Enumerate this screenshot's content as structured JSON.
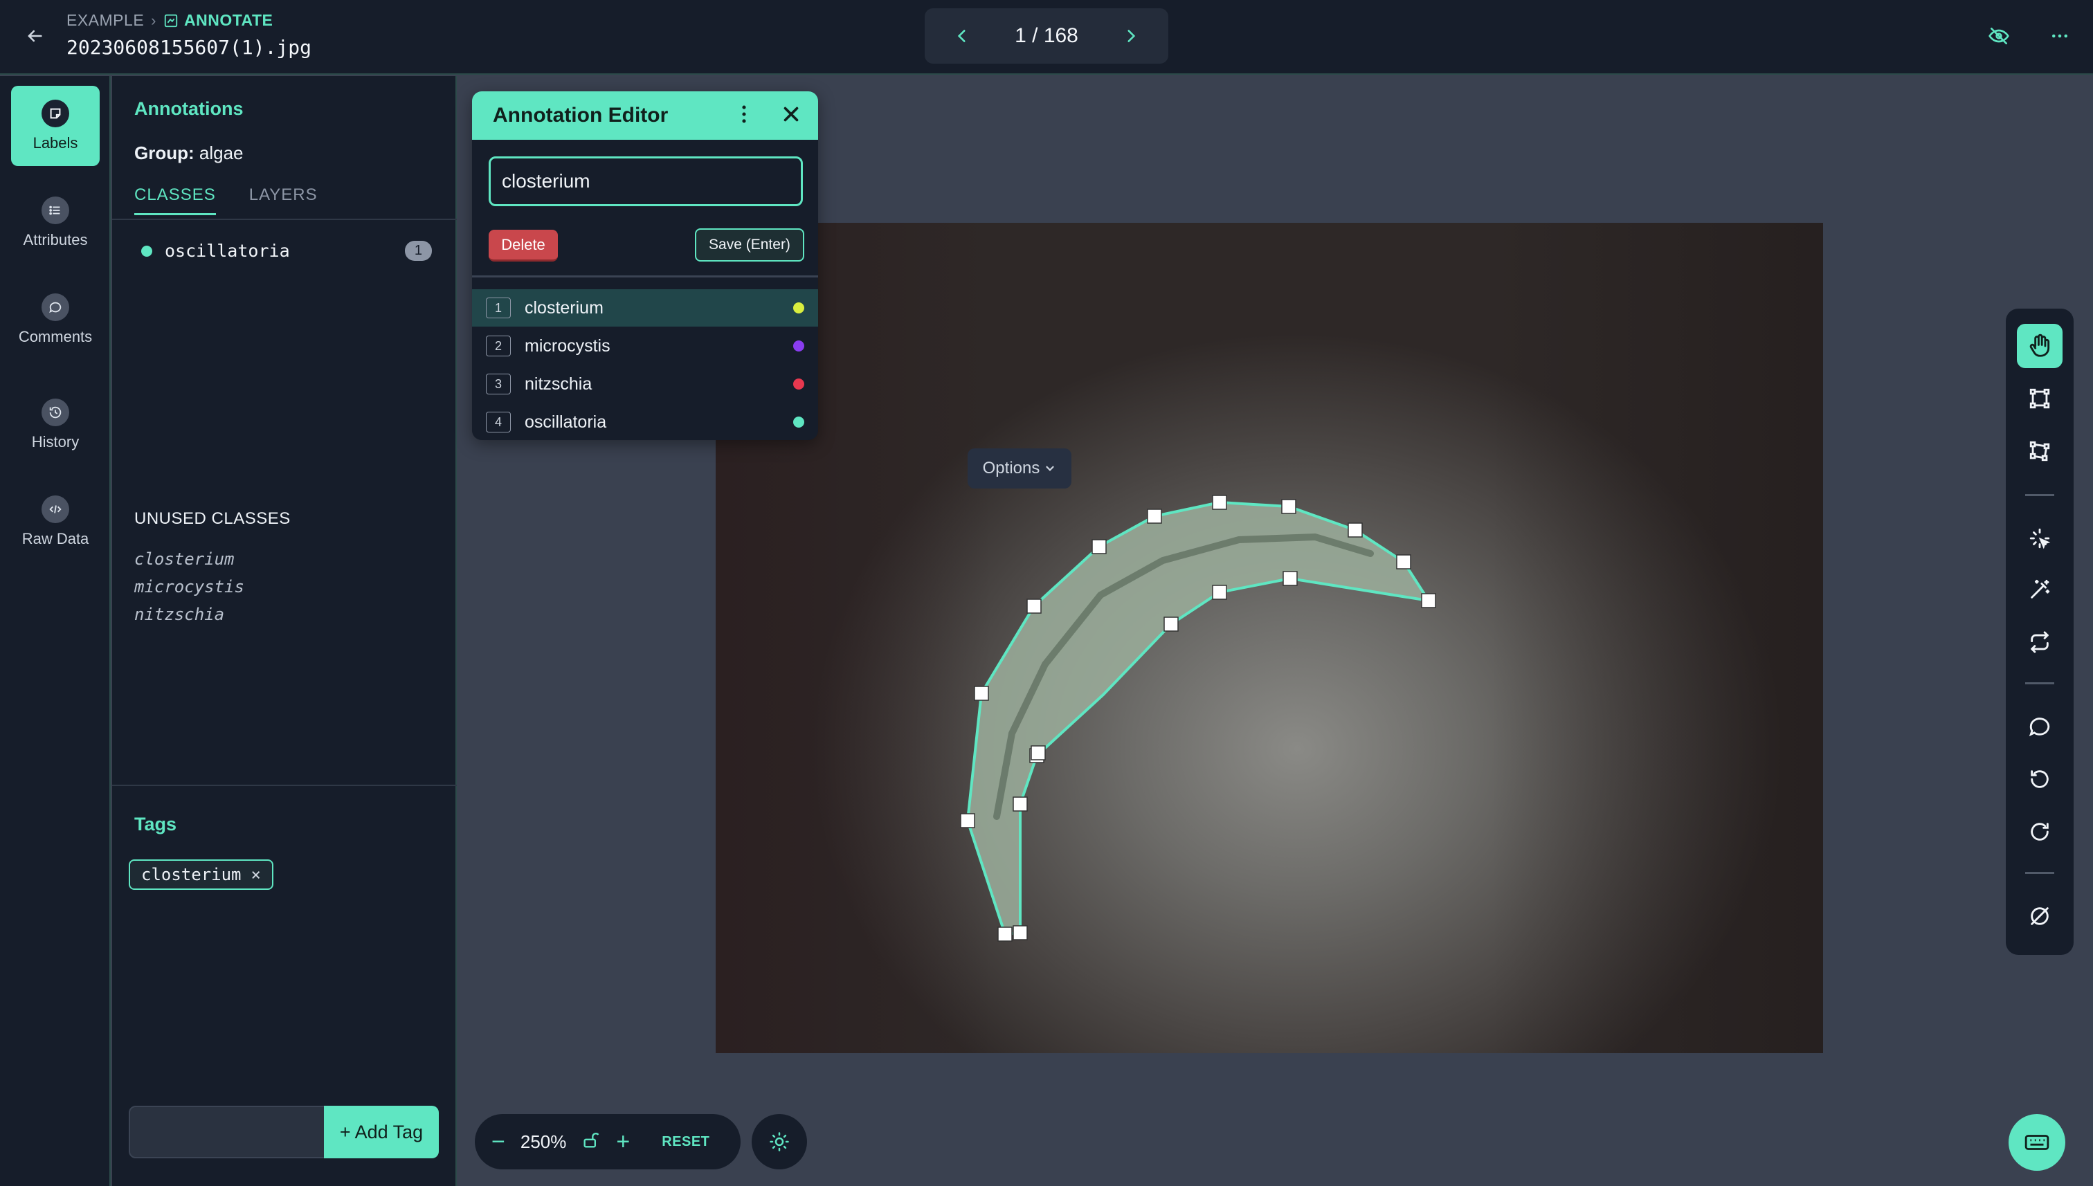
{
  "header": {
    "crumb_project": "EXAMPLE",
    "crumb_section": "ANNOTATE",
    "filename": "20230608155607(1).jpg",
    "pager": "1 / 168"
  },
  "rail": {
    "items": [
      {
        "label": "Labels",
        "icon": "label-icon",
        "active": true
      },
      {
        "label": "Attributes",
        "icon": "list-icon",
        "active": false
      },
      {
        "label": "Comments",
        "icon": "comment-icon",
        "active": false
      },
      {
        "label": "History",
        "icon": "history-icon",
        "active": false
      },
      {
        "label": "Raw Data",
        "icon": "code-icon",
        "active": false
      }
    ]
  },
  "annotations": {
    "title": "Annotations",
    "group_label": "Group:",
    "group_value": "algae",
    "tabs": [
      "CLASSES",
      "LAYERS"
    ],
    "classes": [
      {
        "name": "oscillatoria",
        "count": "1",
        "color": "#5fe6c2"
      }
    ],
    "unused_title": "UNUSED CLASSES",
    "unused": [
      "closterium",
      "microcystis",
      "nitzschia"
    ],
    "tags_title": "Tags",
    "tags": [
      "closterium"
    ],
    "tag_placeholder": "",
    "add_tag_label": "+ Add Tag"
  },
  "editor": {
    "title": "Annotation Editor",
    "input_value": "closterium",
    "delete_label": "Delete",
    "save_label": "Save (Enter)",
    "options": [
      {
        "num": "1",
        "label": "closterium",
        "color": "#d9ee3f",
        "selected": true
      },
      {
        "num": "2",
        "label": "microcystis",
        "color": "#8a3df0",
        "selected": false
      },
      {
        "num": "3",
        "label": "nitzschia",
        "color": "#e8384f",
        "selected": false
      },
      {
        "num": "4",
        "label": "oscillatoria",
        "color": "#5fe6c2",
        "selected": false
      }
    ]
  },
  "canvas": {
    "options_label": "Options"
  },
  "zoom": {
    "value": "250%",
    "reset_label": "RESET"
  },
  "colors": {
    "accent": "#5fe6c2",
    "bg": "#161d2a",
    "canvas_bg": "#3a4150"
  }
}
